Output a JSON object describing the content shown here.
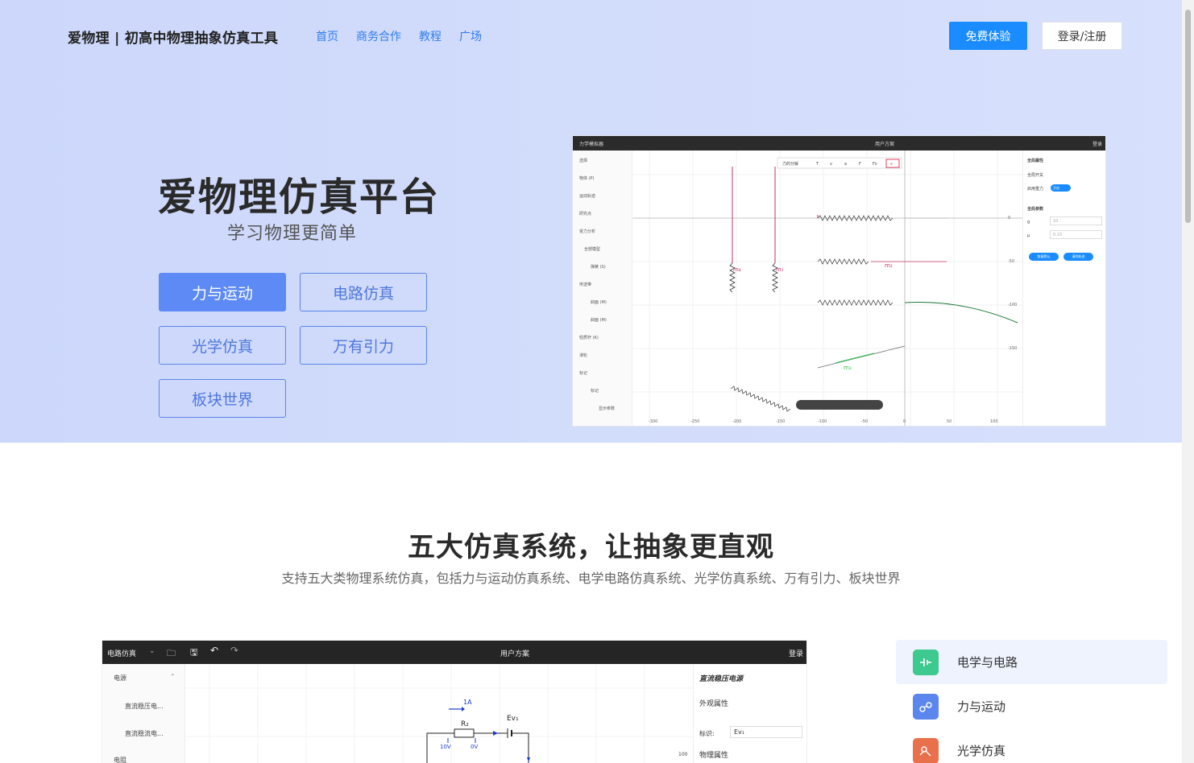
{
  "header": {
    "brand": "爱物理 | 初高中物理抽象仿真工具",
    "nav": [
      "首页",
      "商务合作",
      "教程",
      "广场"
    ],
    "trial_button": "免费体验",
    "login_button": "登录/注册"
  },
  "hero": {
    "title": "爱物理仿真平台",
    "subtitle": "学习物理更简单",
    "categories": [
      "力与运动",
      "电路仿真",
      "光学仿真",
      "万有引力",
      "板块世界"
    ],
    "active_category": "力与运动"
  },
  "hero_screenshot": {
    "app_menu": "力学模拟器",
    "title": "用户方案",
    "login": "登录",
    "left_panel": [
      "选择",
      "物体 (P)",
      "运动轨迹",
      "研究点",
      "受力分析",
      "全部模型",
      "弹簧 (S)",
      "传送带",
      "斜面 (M)",
      "斜面 (M)",
      "轻质杆 (K)",
      "滑轮",
      "标记",
      "标记",
      "显示参数"
    ],
    "toolbar_items": [
      "力的分解",
      "T",
      "v",
      "a",
      "F",
      "Fs",
      "x"
    ],
    "right_panel": {
      "section1": "全局属性",
      "row1": "全局开关",
      "row2": "启用重力",
      "toggle": "开启",
      "section2": "全局参数",
      "g_label": "g",
      "g_value": "10",
      "mu_label": "μ",
      "mu_value": "0.15",
      "btn1": "恢复默认",
      "btn2": "清除轨迹"
    },
    "mass_labels": [
      "m₄",
      "m₁",
      "m₂",
      "m₃"
    ],
    "x_ticks": [
      "-300",
      "-250",
      "-200",
      "-150",
      "-100",
      "-50",
      "0",
      "50",
      "100"
    ],
    "y_ticks": [
      "0",
      "-50",
      "-100",
      "-150"
    ]
  },
  "section2": {
    "title": "五大仿真系统，让抽象更直观",
    "subtitle": "支持五大类物理系统仿真，包括力与运动仿真系统、电学电路仿真系统、光学仿真系统、万有引力、板块世界"
  },
  "circuit_screenshot": {
    "app_menu": "电路仿真",
    "title": "用户方案",
    "login": "登录",
    "left_panel": [
      "电源",
      "直流稳压电...",
      "直流稳流电...",
      "电阻"
    ],
    "right_panel": {
      "title": "直流稳压电源",
      "section1": "外观属性",
      "field_label": "标识:",
      "field_value": "Ev₁",
      "section2": "物理属性"
    },
    "labels": {
      "current": "1A",
      "resistor": "R₂",
      "source": "Ev₁",
      "v1": "10V",
      "v2": "0V",
      "tick": "100"
    }
  },
  "features": [
    {
      "label": "电学与电路",
      "icon": "circuit-icon",
      "color": "#3ec98f"
    },
    {
      "label": "力与运动",
      "icon": "gear-motion-icon",
      "color": "#5b86ee"
    },
    {
      "label": "光学仿真",
      "icon": "optics-icon",
      "color": "#e8704a"
    }
  ]
}
